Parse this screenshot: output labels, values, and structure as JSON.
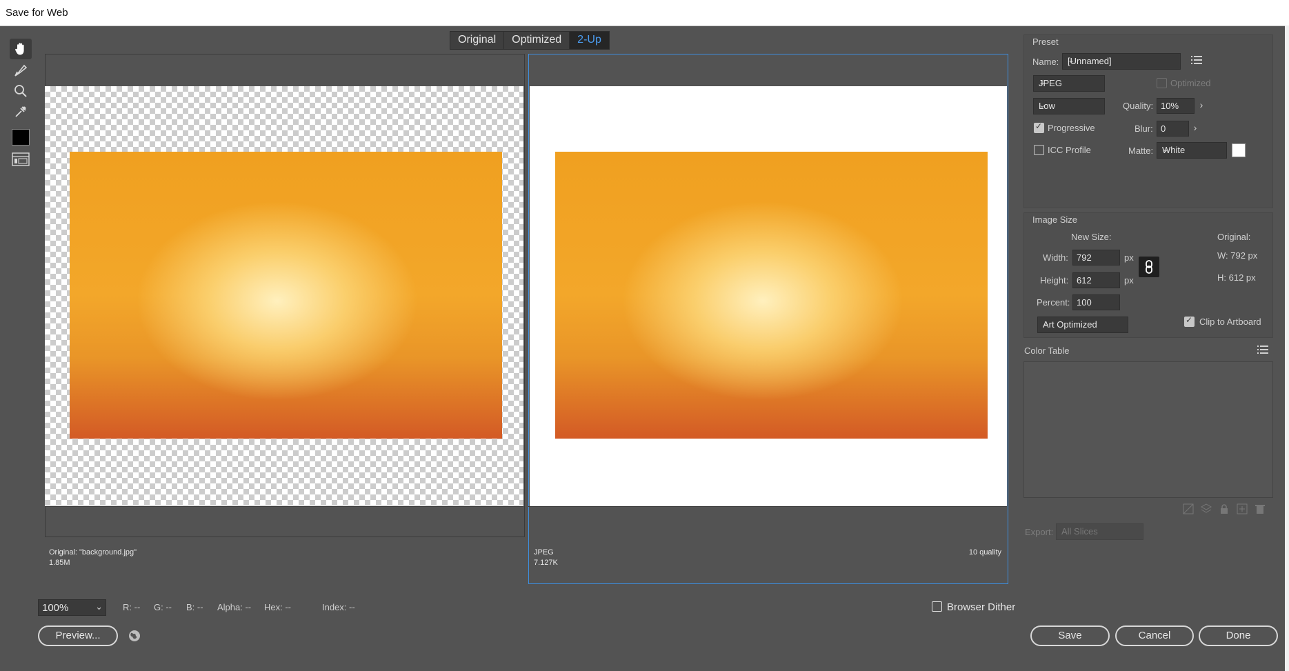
{
  "window": {
    "title": "Save for Web"
  },
  "tools": [
    {
      "name": "hand-tool",
      "icon": "hand-icon"
    },
    {
      "name": "slice-select-tool",
      "icon": "slice-select-icon"
    },
    {
      "name": "zoom-tool",
      "icon": "zoom-icon"
    },
    {
      "name": "eyedropper-tool",
      "icon": "eyedropper-icon"
    },
    {
      "name": "eyedropper-color",
      "icon": "color-swatch-icon"
    },
    {
      "name": "toggle-slices",
      "icon": "slices-visibility-icon"
    }
  ],
  "view_tabs": [
    {
      "label": "Original",
      "active": false
    },
    {
      "label": "Optimized",
      "active": false
    },
    {
      "label": "2-Up",
      "active": true
    }
  ],
  "left_pane": {
    "line1": "Original: \"background.jpg\"",
    "line2": "1.85M"
  },
  "right_pane": {
    "line1": "JPEG",
    "line2": "7.127K",
    "quality_note": "10 quality"
  },
  "preset": {
    "section_label": "Preset",
    "name_label": "Name:",
    "name_value": "[Unnamed]",
    "format": "JPEG",
    "optimized_label": "Optimized",
    "optimized_checked": false,
    "quality_preset": "Low",
    "quality_label": "Quality:",
    "quality_value": "10%",
    "progressive_label": "Progressive",
    "progressive_checked": true,
    "blur_label": "Blur:",
    "blur_value": "0",
    "icc_label": "ICC Profile",
    "icc_checked": false,
    "matte_label": "Matte:",
    "matte_value": "White",
    "matte_color": "#ffffff"
  },
  "image_size": {
    "section_label": "Image Size",
    "new_size_label": "New Size:",
    "original_label": "Original:",
    "width_label": "Width:",
    "width_value": "792",
    "height_label": "Height:",
    "height_value": "612",
    "unit": "px",
    "percent_label": "Percent:",
    "percent_value": "100",
    "orig_w": "W:  792 px",
    "orig_h": "H:   612 px",
    "resample": "Art Optimized",
    "clip_label": "Clip to Artboard",
    "clip_checked": true
  },
  "color_table": {
    "section_label": "Color Table"
  },
  "export": {
    "label": "Export:",
    "value": "All Slices"
  },
  "bottom": {
    "zoom": "100%",
    "r": "R: --",
    "g": "G: --",
    "b": "B: --",
    "alpha": "Alpha: --",
    "hex": "Hex: --",
    "index": "Index: --",
    "browser_dither_label": "Browser Dither",
    "browser_dither_checked": false,
    "preview_label": "Preview...",
    "save_label": "Save",
    "cancel_label": "Cancel",
    "done_label": "Done"
  }
}
